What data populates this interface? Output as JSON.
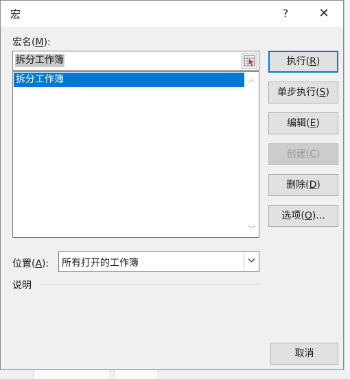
{
  "dialog": {
    "title": "宏",
    "help_glyph": "?",
    "close_glyph": "✕"
  },
  "macro_name": {
    "label_prefix": "宏名(",
    "label_accel": "M",
    "label_suffix": "):",
    "value": "拆分工作簿"
  },
  "macro_list": {
    "items": [
      "拆分工作簿"
    ]
  },
  "buttons": {
    "run": {
      "prefix": "执行(",
      "accel": "R",
      "suffix": ")"
    },
    "step_into": {
      "prefix": "单步执行(",
      "accel": "S",
      "suffix": ")"
    },
    "edit": {
      "prefix": "编辑(",
      "accel": "E",
      "suffix": ")"
    },
    "create": {
      "prefix": "创建(",
      "accel": "C",
      "suffix": ")"
    },
    "delete": {
      "prefix": "删除(",
      "accel": "D",
      "suffix": ")"
    },
    "options": {
      "prefix": "选项(",
      "accel": "O",
      "suffix": ")..."
    },
    "cancel": "取消"
  },
  "location": {
    "label_prefix": "位置(",
    "label_accel": "A",
    "label_suffix": "):",
    "value": "所有打开的工作簿"
  },
  "description": {
    "label": "说明"
  }
}
